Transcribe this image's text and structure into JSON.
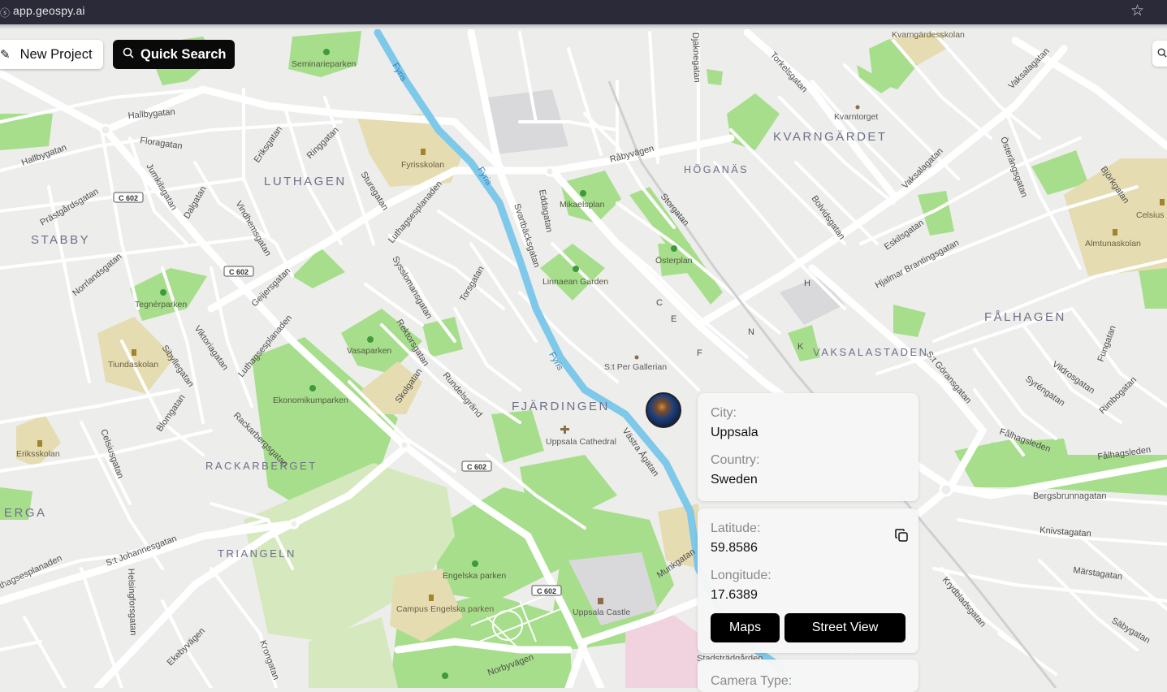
{
  "browser": {
    "url": "app.geospy.ai"
  },
  "toolbar": {
    "new_project_label": "New Project",
    "quick_search_label": "Quick Search"
  },
  "map": {
    "districts": [
      "LUTHAGEN",
      "STABBY",
      "KVARNGÄRDET",
      "HÖGANÄS",
      "FJÄRDINGEN",
      "RACKARBERGET",
      "TRIANGELN",
      "FÅLHAGEN",
      "VAKSALASTADEN",
      "ERGA"
    ],
    "road_shields": [
      "C 602",
      "C 602",
      "C 602",
      "C 602"
    ],
    "pois": {
      "seminarieparken": "Seminarieparken",
      "fyrisskolan": "Fyrisskolan",
      "mikaelsplan": "Mikaelsplan",
      "linnaean_garden": "Linnaean Garden",
      "osterplan": "Österplan",
      "tegnerparken": "Tegnérparken",
      "tiundaskolan": "Tiundaskolan",
      "vasaparken": "Vasaparken",
      "ekonomikumparken": "Ekonomikumparken",
      "eriksskolan": "Eriksskolan",
      "uppsala_cathedral": "Uppsala Cathedral",
      "st_per_galleria": "S:t Per Gallerian",
      "engelska_parken": "Engelska parken",
      "campus_engelska_parken": "Campus Engelska parken",
      "uppsala_castle": "Uppsala Castle",
      "kvarntorget": "Kvarntorget",
      "kvarngardesskolan": "Kvarngärdesskolan",
      "almtunaskolan": "Almtunaskolan",
      "celsius": "Celsius"
    },
    "streets": {
      "fyris": "Fyris",
      "hallbygatan": "Hallbygatan",
      "floragatan": "Floragatan",
      "erikssgatan": "Eriksgatan",
      "ringgatan": "Ringgatan",
      "sturegatan": "Sturegatan",
      "luthagsesplanaden": "Luthagsesplanaden",
      "dalgatan": "Dalgatan",
      "vindhemsgatan": "Vindhemsgatan",
      "jumkilsgatan": "Jumkilsgatan",
      "prastgardsgatan": "Prästgårdsgatan",
      "norrlandsgatan": "Norrlandsgatan",
      "geijersgatan": "Geijersgatan",
      "sysslomansgatan": "Sysslomansgatan",
      "torsgatan": "Torsgatan",
      "eddagatan": "Eddagatan",
      "svartbacksgatan": "Svartbäcksgatan",
      "rabyvagen": "Råbyvägen",
      "storgatan": "Storgatan",
      "torkelsgatan": "Torkelsgatan",
      "djaknegatan": "Djäknegatan",
      "vaksalagatan": "Vaksalagatan",
      "bolividsgatan": "Bolvidsgatan",
      "eskilsgatan": "Eskilsgatan",
      "hjalmar": "Hjalmar Brantingsgatan",
      "osterangsgatan": "Österängsgatan",
      "bjorkgatan": "Björkgatan",
      "rektorsgatan": "Rektorsgatan",
      "skolgatan": "Skolgatan",
      "rundelsgrand": "Rundelsgränd",
      "viktoriagatan": "Viktoriagatan",
      "sibyllegatan": "Sibyllegatan",
      "blomgatan": "Blomgatan",
      "rackarbergsgatan": "Rackarbergsgatan",
      "celsiusgatan": "Celsiusgatan",
      "st_johannesgatan": "S:t Johannesgatan",
      "helsingforsgatan": "Helsingforsgatan",
      "ekebyvagen": "Ekebyvägen",
      "krongatan": "Krongatan",
      "norbyvagen": "Norbyvägen",
      "vastra_agatan": "Västra Ågatan",
      "munkgatan": "Munkgatan",
      "stadstradgarden": "Stadsträdgården",
      "st_goransgatan": "S:t Göransgatan",
      "vildrosgatan": "Vildrosgatan",
      "syrengatan": "Syréngatan",
      "rimbogatan": "Rimbogatan",
      "fungatan": "Fungatan",
      "falhagsleden": "Fålhagsleden",
      "bergsbrunnagatan": "Bergsbrunnagatan",
      "knivstagatan": "Knivstagatan",
      "marstagatan": "Märstagatan",
      "sabygatan": "Säbygatan",
      "krydbladsgatan": "Krydbladsgatan",
      "letters": [
        "C",
        "E",
        "F",
        "H",
        "N",
        "K"
      ]
    }
  },
  "result": {
    "city_label": "City:",
    "city_value": "Uppsala",
    "country_label": "Country:",
    "country_value": "Sweden",
    "latitude_label": "Latitude:",
    "latitude_value": "59.8586",
    "longitude_label": "Longitude:",
    "longitude_value": "17.6389",
    "maps_label": "Maps",
    "street_view_label": "Street View",
    "camera_type_label": "Camera Type:"
  },
  "colors": {
    "park": "#a7de8c",
    "school": "#e5dcb2",
    "water": "#7ec8ea",
    "road": "#ffffff",
    "background": "#ededeb",
    "button_dark": "#0a0a0a"
  },
  "icons": {
    "new_project": "pencil-icon",
    "quick_search": "search-icon",
    "bookmark": "star-icon",
    "copy": "copy-icon"
  }
}
